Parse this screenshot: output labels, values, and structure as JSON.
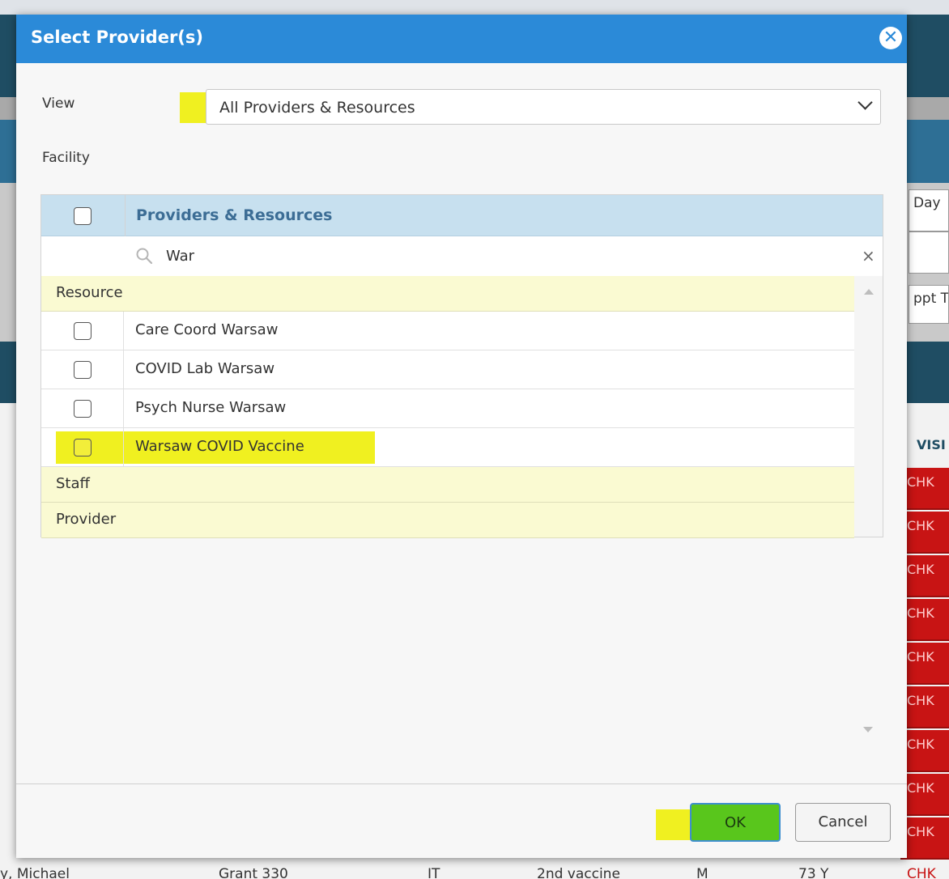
{
  "background": {
    "right_cells": [
      "Day",
      "",
      "ppt Ti"
    ],
    "visit_header": "VISI",
    "status_cells": [
      "CHK",
      "CHK",
      "CHK",
      "CHK",
      "CHK",
      "CHK",
      "CHK",
      "CHK",
      "CHK"
    ],
    "bottom_row": {
      "name": "y, Michael",
      "location": "Grant 330",
      "type": "IT",
      "reason": "2nd vaccine",
      "sex": "M",
      "age": "73 Y",
      "status": "CHK"
    }
  },
  "dialog": {
    "title": "Select Provider(s)",
    "close_glyph": "✕",
    "view_label": "View",
    "view_value": "All Providers & Resources",
    "facility_label": "Facility",
    "grid": {
      "header": "Providers & Resources",
      "filter_value": "War",
      "clear_glyph": "×",
      "groups": {
        "resource": "Resource",
        "staff": "Staff",
        "provider": "Provider"
      },
      "items": [
        {
          "label": "Care Coord Warsaw",
          "checked": false
        },
        {
          "label": "COVID Lab Warsaw",
          "checked": false
        },
        {
          "label": "Psych Nurse Warsaw",
          "checked": false
        },
        {
          "label": "Warsaw COVID Vaccine",
          "checked": false,
          "highlighted": true
        }
      ]
    },
    "buttons": {
      "ok": "OK",
      "cancel": "Cancel"
    }
  },
  "colors": {
    "header_blue": "#2b8ad8",
    "highlight": "#f0f020",
    "ok_green": "#59c61c",
    "status_red": "#c81414"
  }
}
